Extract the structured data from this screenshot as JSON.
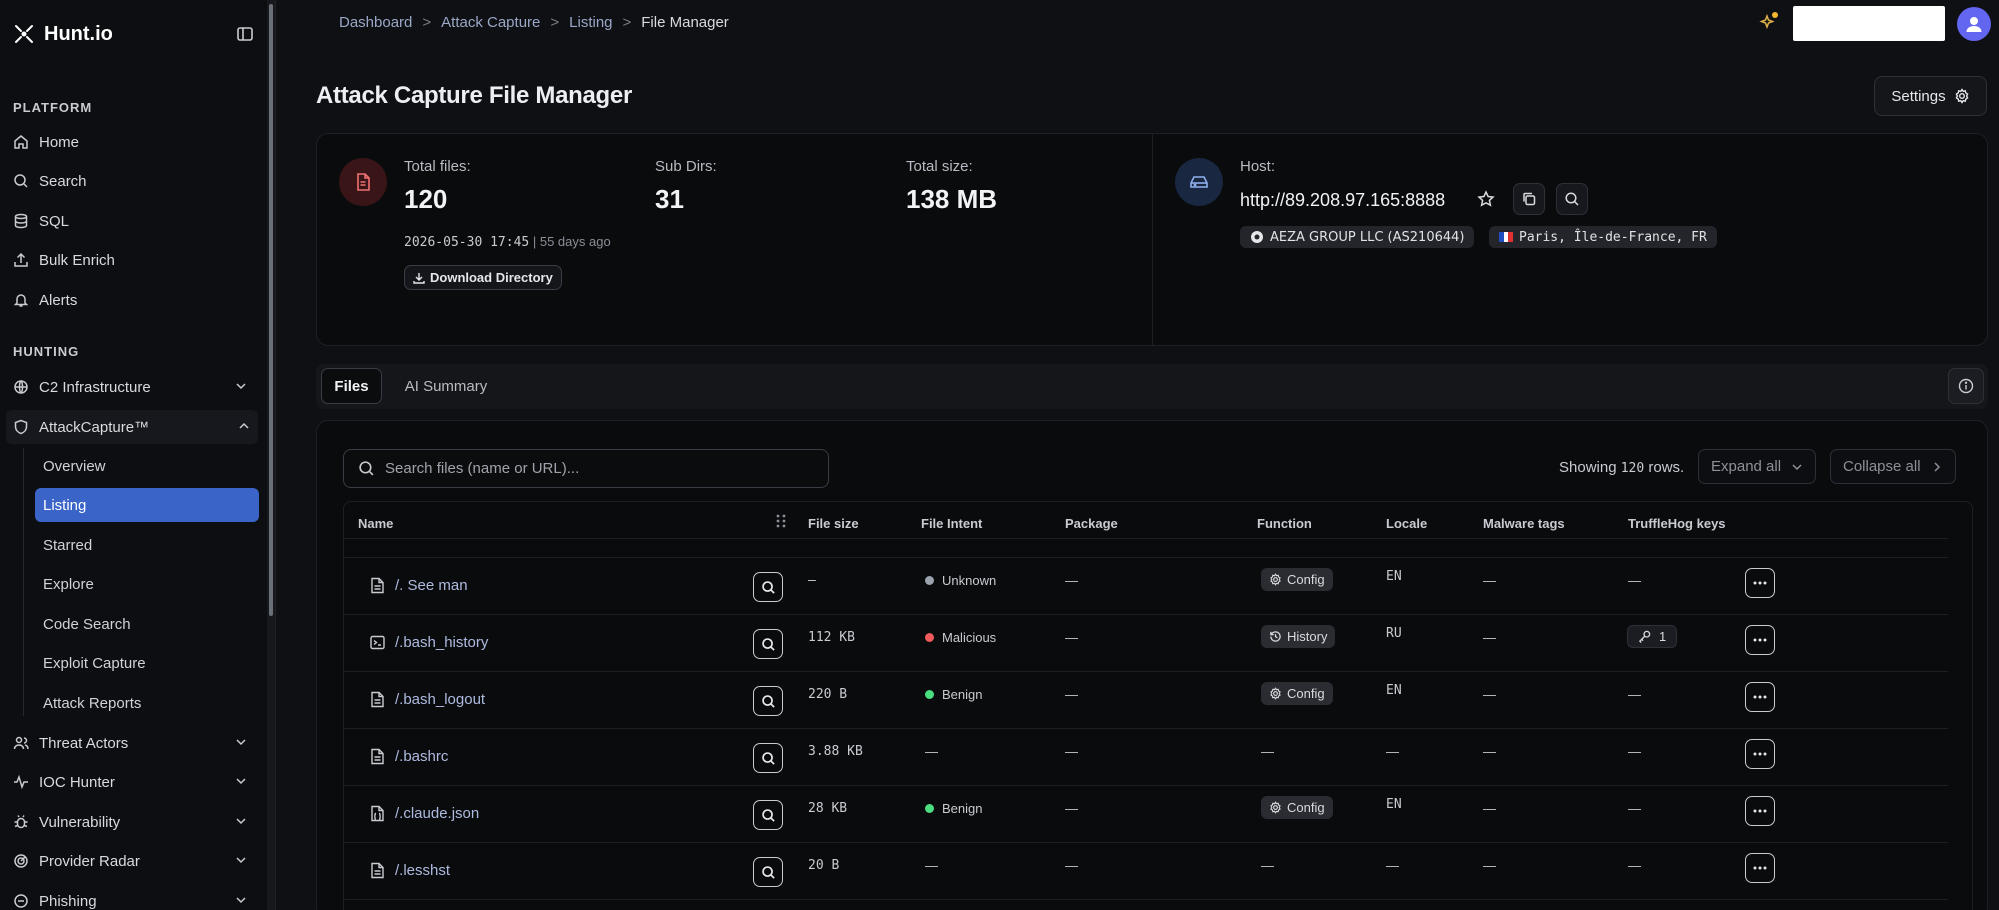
{
  "app": {
    "logo_text": "Hunt.io"
  },
  "sidebar": {
    "platform_title": "PLATFORM",
    "platform_items": [
      {
        "label": "Home",
        "icon": "home-icon"
      },
      {
        "label": "Search",
        "icon": "search-icon"
      },
      {
        "label": "SQL",
        "icon": "database-icon"
      },
      {
        "label": "Bulk Enrich",
        "icon": "upload-icon"
      },
      {
        "label": "Alerts",
        "icon": "bell-icon"
      }
    ],
    "hunting_title": "HUNTING",
    "c2": "C2 Infrastructure",
    "attack_capture": "AttackCapture™",
    "sub_items": [
      "Overview",
      "Listing",
      "Starred",
      "Explore",
      "Code Search",
      "Exploit Capture",
      "Attack Reports"
    ],
    "active_sub": "Listing",
    "more_items": [
      "Threat Actors",
      "IOC Hunter",
      "Vulnerability",
      "Provider Radar",
      "Phishing"
    ]
  },
  "breadcrumb": [
    "Dashboard",
    "Attack Capture",
    "Listing",
    "File Manager"
  ],
  "page": {
    "title": "Attack Capture File Manager",
    "settings_label": "Settings"
  },
  "summary": {
    "total_files_label": "Total files:",
    "total_files": "120",
    "sub_dirs_label": "Sub Dirs:",
    "sub_dirs": "31",
    "total_size_label": "Total size:",
    "total_size": "138 MB",
    "date": "2026-05-30 17:45",
    "ago": "| 55 days ago",
    "download_label": "Download Directory",
    "host_label": "Host:",
    "host_url": "http://89.208.97.165:8888",
    "asn": "AEZA GROUP LLC (AS210644)",
    "location": "Paris, Île-de-France, FR"
  },
  "tabs": {
    "files": "Files",
    "ai_summary": "AI Summary"
  },
  "files": {
    "search_placeholder": "Search files (name or URL)...",
    "showing_prefix": "Showing ",
    "showing_count": "120",
    "showing_suffix": " rows.",
    "expand_all": "Expand all",
    "collapse_all": "Collapse all",
    "columns": [
      "Name",
      "File size",
      "File Intent",
      "Package",
      "Function",
      "Locale",
      "Malware tags",
      "TruffleHog keys"
    ],
    "rows": [
      {
        "name": "/. See man",
        "size": "—",
        "intent": "Unknown",
        "intent_color": "#9ca3af",
        "package": "—",
        "function": "Config",
        "locale": "EN",
        "tags": "—",
        "keys": "—"
      },
      {
        "name": "/.bash_history",
        "size": "112 KB",
        "intent": "Malicious",
        "intent_color": "#f05a5a",
        "package": "—",
        "function": "History",
        "locale": "RU",
        "tags": "—",
        "keys": "1"
      },
      {
        "name": "/.bash_logout",
        "size": "220 B",
        "intent": "Benign",
        "intent_color": "#4ade80",
        "package": "—",
        "function": "Config",
        "locale": "EN",
        "tags": "—",
        "keys": "—"
      },
      {
        "name": "/.bashrc",
        "size": "3.88 KB",
        "intent": "—",
        "intent_color": "",
        "package": "—",
        "function": "—",
        "locale": "—",
        "tags": "—",
        "keys": "—"
      },
      {
        "name": "/.claude.json",
        "size": "28 KB",
        "intent": "Benign",
        "intent_color": "#4ade80",
        "package": "—",
        "function": "Config",
        "locale": "EN",
        "tags": "—",
        "keys": "—"
      },
      {
        "name": "/.lesshst",
        "size": "20 B",
        "intent": "—",
        "intent_color": "",
        "package": "—",
        "function": "—",
        "locale": "—",
        "tags": "—",
        "keys": "—"
      }
    ]
  }
}
